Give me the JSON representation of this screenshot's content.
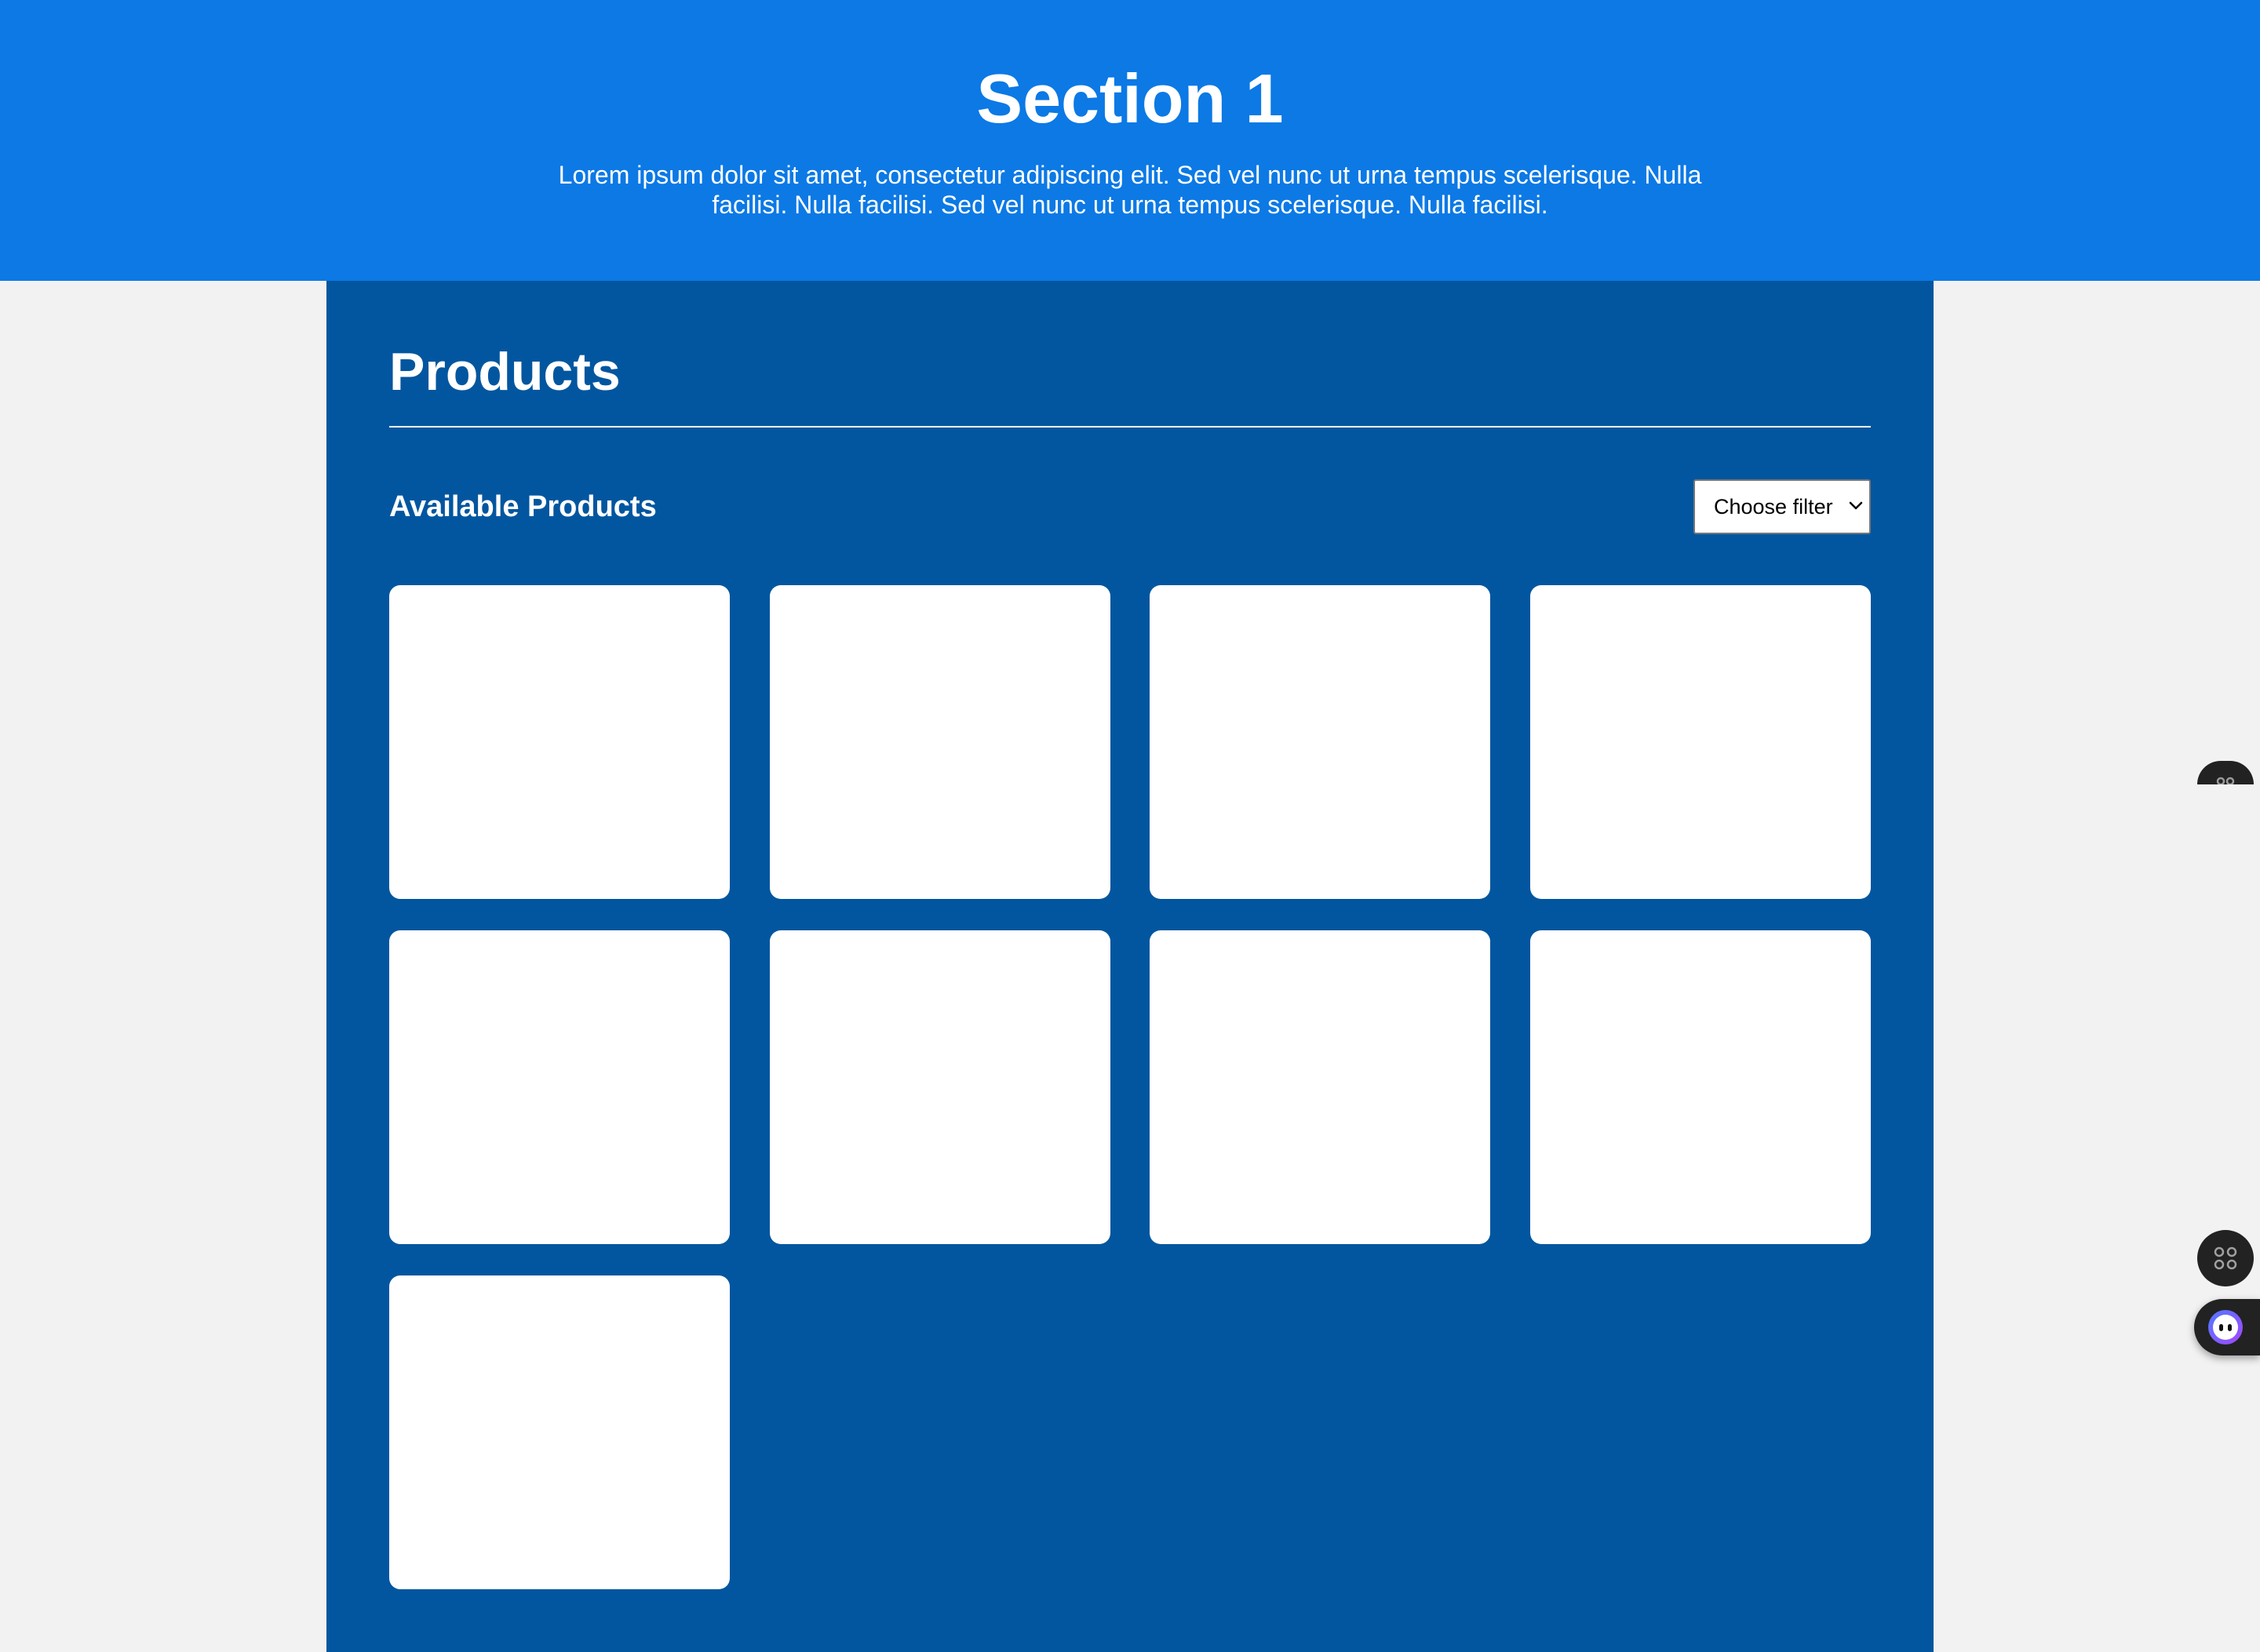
{
  "hero": {
    "title": "Section 1",
    "description": "Lorem ipsum dolor sit amet, consectetur adipiscing elit. Sed vel nunc ut urna tempus scelerisque. Nulla facilisi. Nulla facilisi. Sed vel nunc ut urna tempus scelerisque. Nulla facilisi."
  },
  "products": {
    "title": "Products",
    "subtitle": "Available Products",
    "filter": {
      "selected": "Choose filter"
    },
    "card_count": 9
  },
  "floating_widgets": {
    "icons": [
      "command-icon",
      "assistant-face-icon"
    ]
  },
  "colors": {
    "hero_background": "#0c79e5",
    "panel_background": "#02569f",
    "page_background": "#f2f2f2",
    "card_background": "#ffffff"
  }
}
